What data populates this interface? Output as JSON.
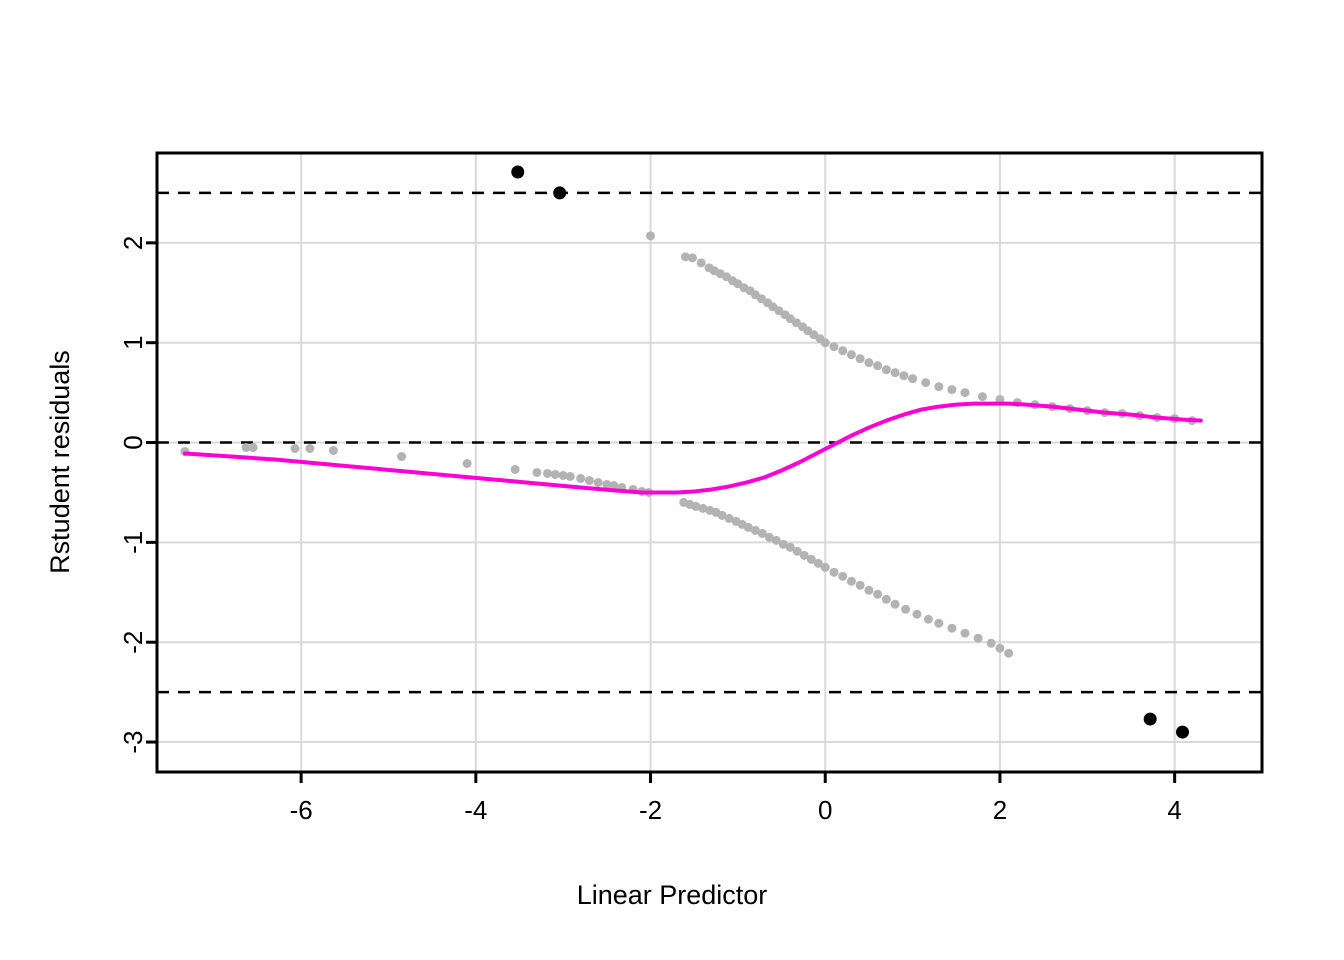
{
  "chart_data": {
    "type": "scatter",
    "title": "",
    "xlabel": "Linear Predictor",
    "ylabel": "Rstudent residuals",
    "xlim": [
      -7.65,
      5.0
    ],
    "ylim": [
      -3.3,
      2.9
    ],
    "xticks": [
      -6,
      -4,
      -2,
      0,
      2,
      4
    ],
    "xtick_labels": [
      "-6",
      "-4",
      "-2",
      "0",
      "2",
      "4"
    ],
    "yticks": [
      2,
      1,
      0,
      -1,
      -2,
      -3
    ],
    "ytick_labels": [
      "2",
      "1",
      "0",
      "-1",
      "-2",
      "-3"
    ],
    "grid": true,
    "grid_color": "#d9d9d9",
    "legend": "none",
    "reference_lines": [
      {
        "name": "upper-threshold",
        "y": 2.5,
        "style": "dashed",
        "color": "#000000"
      },
      {
        "name": "zero-line",
        "y": 0,
        "style": "dashed",
        "color": "#000000"
      },
      {
        "name": "lower-threshold",
        "y": -2.5,
        "style": "dashed",
        "color": "#000000"
      }
    ],
    "series": [
      {
        "name": "residuals",
        "marker": "filled-circle",
        "color": "#b3b3b3",
        "size": 9,
        "points": [
          [
            -7.33,
            -0.09
          ],
          [
            -6.63,
            -0.05
          ],
          [
            -6.55,
            -0.05
          ],
          [
            -6.07,
            -0.06
          ],
          [
            -5.9,
            -0.06
          ],
          [
            -5.63,
            -0.08
          ],
          [
            -4.85,
            -0.14
          ],
          [
            -4.1,
            -0.21
          ],
          [
            -3.55,
            -0.27
          ],
          [
            -3.3,
            -0.3
          ],
          [
            -3.18,
            -0.31
          ],
          [
            -3.09,
            -0.32
          ],
          [
            -3.0,
            -0.33
          ],
          [
            -2.92,
            -0.34
          ],
          [
            -2.8,
            -0.36
          ],
          [
            -2.7,
            -0.38
          ],
          [
            -2.6,
            -0.4
          ],
          [
            -2.5,
            -0.42
          ],
          [
            -2.42,
            -0.43
          ],
          [
            -2.33,
            -0.45
          ],
          [
            -2.2,
            -0.47
          ],
          [
            -2.1,
            -0.49
          ],
          [
            -2.02,
            -0.5
          ],
          [
            -2.0,
            2.07
          ],
          [
            -1.6,
            1.86
          ],
          [
            -1.52,
            1.85
          ],
          [
            -1.42,
            1.8
          ],
          [
            -1.33,
            1.75
          ],
          [
            -1.27,
            1.72
          ],
          [
            -1.2,
            1.69
          ],
          [
            -1.13,
            1.66
          ],
          [
            -1.06,
            1.62
          ],
          [
            -1.0,
            1.59
          ],
          [
            -0.93,
            1.55
          ],
          [
            -0.86,
            1.52
          ],
          [
            -0.8,
            1.48
          ],
          [
            -0.73,
            1.44
          ],
          [
            -0.66,
            1.4
          ],
          [
            -0.6,
            1.36
          ],
          [
            -0.53,
            1.32
          ],
          [
            -0.46,
            1.28
          ],
          [
            -0.4,
            1.24
          ],
          [
            -0.33,
            1.2
          ],
          [
            -0.26,
            1.16
          ],
          [
            -0.2,
            1.12
          ],
          [
            -0.13,
            1.08
          ],
          [
            -0.06,
            1.04
          ],
          [
            0.0,
            1.0
          ],
          [
            0.1,
            0.96
          ],
          [
            0.2,
            0.92
          ],
          [
            0.3,
            0.88
          ],
          [
            0.4,
            0.84
          ],
          [
            0.5,
            0.8
          ],
          [
            0.6,
            0.77
          ],
          [
            0.7,
            0.73
          ],
          [
            0.8,
            0.7
          ],
          [
            0.9,
            0.67
          ],
          [
            1.0,
            0.64
          ],
          [
            1.15,
            0.6
          ],
          [
            1.3,
            0.56
          ],
          [
            1.45,
            0.53
          ],
          [
            1.6,
            0.5
          ],
          [
            1.8,
            0.46
          ],
          [
            2.0,
            0.43
          ],
          [
            2.2,
            0.4
          ],
          [
            2.4,
            0.38
          ],
          [
            2.6,
            0.36
          ],
          [
            2.8,
            0.34
          ],
          [
            3.0,
            0.32
          ],
          [
            3.2,
            0.3
          ],
          [
            3.4,
            0.29
          ],
          [
            3.6,
            0.27
          ],
          [
            3.8,
            0.25
          ],
          [
            4.0,
            0.24
          ],
          [
            4.2,
            0.22
          ],
          [
            -1.62,
            -0.6
          ],
          [
            -1.55,
            -0.62
          ],
          [
            -1.48,
            -0.64
          ],
          [
            -1.4,
            -0.66
          ],
          [
            -1.32,
            -0.68
          ],
          [
            -1.25,
            -0.7
          ],
          [
            -1.18,
            -0.73
          ],
          [
            -1.1,
            -0.76
          ],
          [
            -1.02,
            -0.79
          ],
          [
            -0.95,
            -0.82
          ],
          [
            -0.88,
            -0.85
          ],
          [
            -0.8,
            -0.88
          ],
          [
            -0.72,
            -0.91
          ],
          [
            -0.64,
            -0.95
          ],
          [
            -0.56,
            -0.98
          ],
          [
            -0.48,
            -1.02
          ],
          [
            -0.4,
            -1.05
          ],
          [
            -0.32,
            -1.09
          ],
          [
            -0.24,
            -1.13
          ],
          [
            -0.16,
            -1.17
          ],
          [
            -0.08,
            -1.21
          ],
          [
            0.0,
            -1.25
          ],
          [
            0.1,
            -1.3
          ],
          [
            0.2,
            -1.34
          ],
          [
            0.3,
            -1.39
          ],
          [
            0.4,
            -1.43
          ],
          [
            0.5,
            -1.48
          ],
          [
            0.6,
            -1.52
          ],
          [
            0.7,
            -1.57
          ],
          [
            0.8,
            -1.62
          ],
          [
            0.92,
            -1.67
          ],
          [
            1.05,
            -1.72
          ],
          [
            1.18,
            -1.77
          ],
          [
            1.3,
            -1.81
          ],
          [
            1.45,
            -1.86
          ],
          [
            1.6,
            -1.91
          ],
          [
            1.75,
            -1.96
          ],
          [
            1.9,
            -2.01
          ],
          [
            2.0,
            -2.06
          ],
          [
            2.1,
            -2.11
          ]
        ]
      },
      {
        "name": "outliers",
        "marker": "filled-circle",
        "color": "#000000",
        "size": 13,
        "points": [
          [
            -3.52,
            2.71
          ],
          [
            -3.04,
            2.5
          ],
          [
            3.72,
            -2.77
          ],
          [
            4.09,
            -2.9
          ]
        ]
      }
    ],
    "smoother": {
      "name": "loess-fit",
      "color": "#ff00d4",
      "width": 4,
      "points": [
        [
          -7.33,
          -0.11
        ],
        [
          -6.8,
          -0.14
        ],
        [
          -6.3,
          -0.17
        ],
        [
          -5.8,
          -0.21
        ],
        [
          -5.3,
          -0.25
        ],
        [
          -4.8,
          -0.29
        ],
        [
          -4.3,
          -0.33
        ],
        [
          -3.8,
          -0.37
        ],
        [
          -3.3,
          -0.41
        ],
        [
          -2.8,
          -0.45
        ],
        [
          -2.4,
          -0.48
        ],
        [
          -2.1,
          -0.5
        ],
        [
          -1.9,
          -0.5
        ],
        [
          -1.7,
          -0.5
        ],
        [
          -1.5,
          -0.49
        ],
        [
          -1.3,
          -0.47
        ],
        [
          -1.1,
          -0.44
        ],
        [
          -0.9,
          -0.4
        ],
        [
          -0.7,
          -0.35
        ],
        [
          -0.5,
          -0.28
        ],
        [
          -0.3,
          -0.2
        ],
        [
          -0.1,
          -0.11
        ],
        [
          0.1,
          -0.02
        ],
        [
          0.3,
          0.07
        ],
        [
          0.5,
          0.15
        ],
        [
          0.7,
          0.22
        ],
        [
          0.9,
          0.28
        ],
        [
          1.1,
          0.33
        ],
        [
          1.3,
          0.36
        ],
        [
          1.5,
          0.38
        ],
        [
          1.7,
          0.39
        ],
        [
          1.9,
          0.39
        ],
        [
          2.1,
          0.39
        ],
        [
          2.3,
          0.38
        ],
        [
          2.6,
          0.36
        ],
        [
          2.9,
          0.33
        ],
        [
          3.2,
          0.3
        ],
        [
          3.5,
          0.28
        ],
        [
          3.8,
          0.25
        ],
        [
          4.1,
          0.23
        ],
        [
          4.3,
          0.22
        ]
      ]
    }
  }
}
